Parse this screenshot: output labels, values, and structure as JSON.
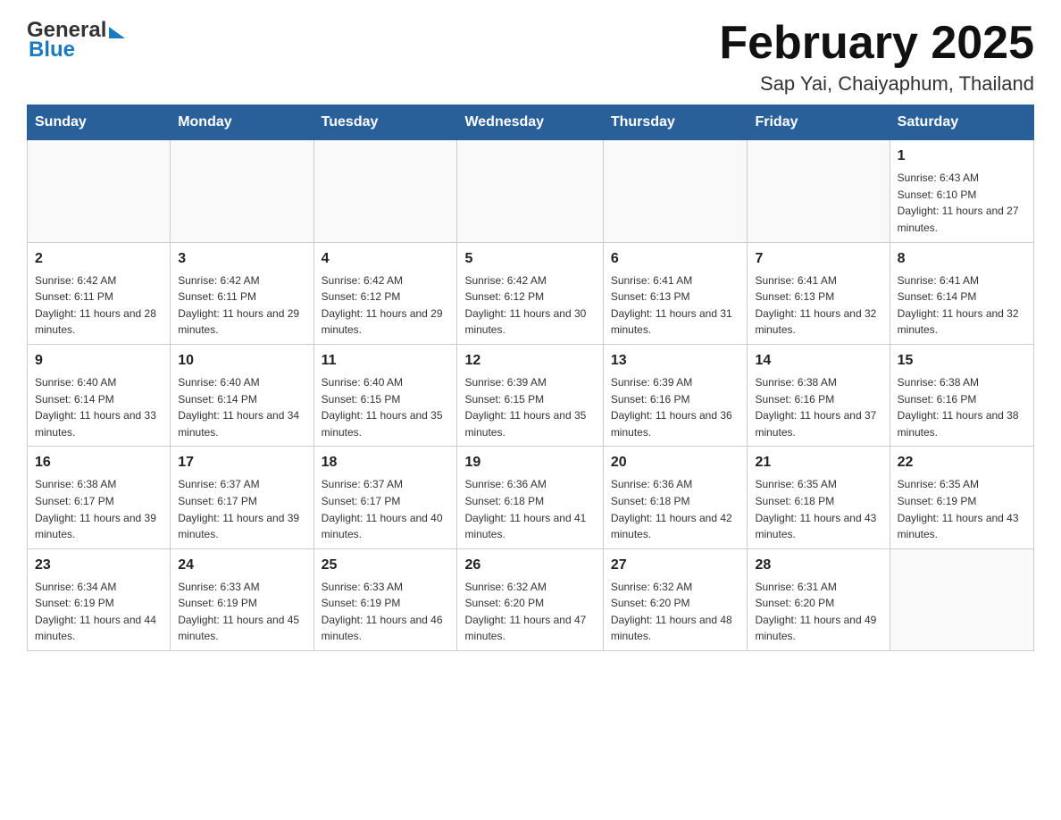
{
  "header": {
    "logo": {
      "general": "General",
      "blue": "Blue"
    },
    "title": "February 2025",
    "subtitle": "Sap Yai, Chaiyaphum, Thailand"
  },
  "calendar": {
    "days_of_week": [
      "Sunday",
      "Monday",
      "Tuesday",
      "Wednesday",
      "Thursday",
      "Friday",
      "Saturday"
    ],
    "weeks": [
      {
        "cells": [
          {
            "day": "",
            "info": ""
          },
          {
            "day": "",
            "info": ""
          },
          {
            "day": "",
            "info": ""
          },
          {
            "day": "",
            "info": ""
          },
          {
            "day": "",
            "info": ""
          },
          {
            "day": "",
            "info": ""
          },
          {
            "day": "1",
            "info": "Sunrise: 6:43 AM\nSunset: 6:10 PM\nDaylight: 11 hours and 27 minutes."
          }
        ]
      },
      {
        "cells": [
          {
            "day": "2",
            "info": "Sunrise: 6:42 AM\nSunset: 6:11 PM\nDaylight: 11 hours and 28 minutes."
          },
          {
            "day": "3",
            "info": "Sunrise: 6:42 AM\nSunset: 6:11 PM\nDaylight: 11 hours and 29 minutes."
          },
          {
            "day": "4",
            "info": "Sunrise: 6:42 AM\nSunset: 6:12 PM\nDaylight: 11 hours and 29 minutes."
          },
          {
            "day": "5",
            "info": "Sunrise: 6:42 AM\nSunset: 6:12 PM\nDaylight: 11 hours and 30 minutes."
          },
          {
            "day": "6",
            "info": "Sunrise: 6:41 AM\nSunset: 6:13 PM\nDaylight: 11 hours and 31 minutes."
          },
          {
            "day": "7",
            "info": "Sunrise: 6:41 AM\nSunset: 6:13 PM\nDaylight: 11 hours and 32 minutes."
          },
          {
            "day": "8",
            "info": "Sunrise: 6:41 AM\nSunset: 6:14 PM\nDaylight: 11 hours and 32 minutes."
          }
        ]
      },
      {
        "cells": [
          {
            "day": "9",
            "info": "Sunrise: 6:40 AM\nSunset: 6:14 PM\nDaylight: 11 hours and 33 minutes."
          },
          {
            "day": "10",
            "info": "Sunrise: 6:40 AM\nSunset: 6:14 PM\nDaylight: 11 hours and 34 minutes."
          },
          {
            "day": "11",
            "info": "Sunrise: 6:40 AM\nSunset: 6:15 PM\nDaylight: 11 hours and 35 minutes."
          },
          {
            "day": "12",
            "info": "Sunrise: 6:39 AM\nSunset: 6:15 PM\nDaylight: 11 hours and 35 minutes."
          },
          {
            "day": "13",
            "info": "Sunrise: 6:39 AM\nSunset: 6:16 PM\nDaylight: 11 hours and 36 minutes."
          },
          {
            "day": "14",
            "info": "Sunrise: 6:38 AM\nSunset: 6:16 PM\nDaylight: 11 hours and 37 minutes."
          },
          {
            "day": "15",
            "info": "Sunrise: 6:38 AM\nSunset: 6:16 PM\nDaylight: 11 hours and 38 minutes."
          }
        ]
      },
      {
        "cells": [
          {
            "day": "16",
            "info": "Sunrise: 6:38 AM\nSunset: 6:17 PM\nDaylight: 11 hours and 39 minutes."
          },
          {
            "day": "17",
            "info": "Sunrise: 6:37 AM\nSunset: 6:17 PM\nDaylight: 11 hours and 39 minutes."
          },
          {
            "day": "18",
            "info": "Sunrise: 6:37 AM\nSunset: 6:17 PM\nDaylight: 11 hours and 40 minutes."
          },
          {
            "day": "19",
            "info": "Sunrise: 6:36 AM\nSunset: 6:18 PM\nDaylight: 11 hours and 41 minutes."
          },
          {
            "day": "20",
            "info": "Sunrise: 6:36 AM\nSunset: 6:18 PM\nDaylight: 11 hours and 42 minutes."
          },
          {
            "day": "21",
            "info": "Sunrise: 6:35 AM\nSunset: 6:18 PM\nDaylight: 11 hours and 43 minutes."
          },
          {
            "day": "22",
            "info": "Sunrise: 6:35 AM\nSunset: 6:19 PM\nDaylight: 11 hours and 43 minutes."
          }
        ]
      },
      {
        "cells": [
          {
            "day": "23",
            "info": "Sunrise: 6:34 AM\nSunset: 6:19 PM\nDaylight: 11 hours and 44 minutes."
          },
          {
            "day": "24",
            "info": "Sunrise: 6:33 AM\nSunset: 6:19 PM\nDaylight: 11 hours and 45 minutes."
          },
          {
            "day": "25",
            "info": "Sunrise: 6:33 AM\nSunset: 6:19 PM\nDaylight: 11 hours and 46 minutes."
          },
          {
            "day": "26",
            "info": "Sunrise: 6:32 AM\nSunset: 6:20 PM\nDaylight: 11 hours and 47 minutes."
          },
          {
            "day": "27",
            "info": "Sunrise: 6:32 AM\nSunset: 6:20 PM\nDaylight: 11 hours and 48 minutes."
          },
          {
            "day": "28",
            "info": "Sunrise: 6:31 AM\nSunset: 6:20 PM\nDaylight: 11 hours and 49 minutes."
          },
          {
            "day": "",
            "info": ""
          }
        ]
      }
    ]
  }
}
